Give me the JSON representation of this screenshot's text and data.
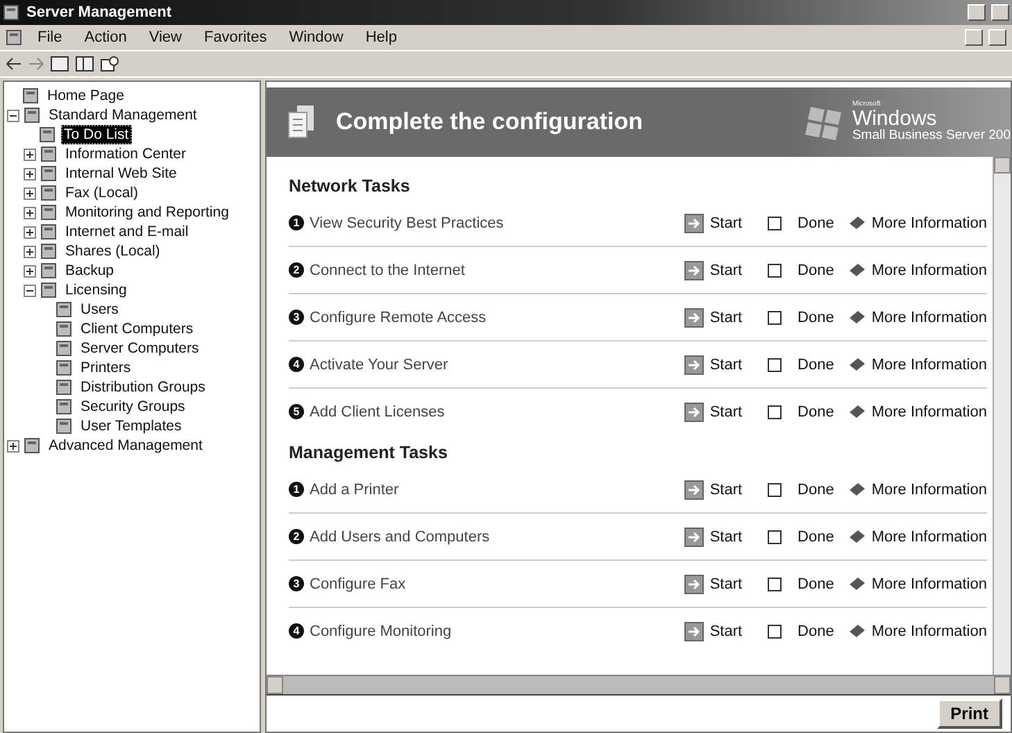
{
  "window": {
    "title": "Server Management"
  },
  "menu": [
    "File",
    "Action",
    "View",
    "Favorites",
    "Window",
    "Help"
  ],
  "tree": [
    {
      "label": "Home Page",
      "selected": false
    },
    {
      "label": "Standard Management",
      "selected": false,
      "expanded": true,
      "children": [
        {
          "label": "To Do List",
          "selected": true
        },
        {
          "label": "Information Center",
          "selected": false,
          "expanded": false
        },
        {
          "label": "Internal Web Site",
          "selected": false,
          "expanded": false
        },
        {
          "label": "Fax (Local)",
          "selected": false,
          "expanded": false
        },
        {
          "label": "Monitoring and Reporting",
          "selected": false,
          "expanded": false
        },
        {
          "label": "Internet and E-mail",
          "selected": false,
          "expanded": false
        },
        {
          "label": "Shares (Local)",
          "selected": false,
          "expanded": false
        },
        {
          "label": "Backup",
          "selected": false,
          "expanded": false
        },
        {
          "label": "Licensing",
          "selected": false,
          "expanded": true,
          "children": [
            {
              "label": "Users",
              "selected": false
            },
            {
              "label": "Client Computers",
              "selected": false
            },
            {
              "label": "Server Computers",
              "selected": false
            },
            {
              "label": "Printers",
              "selected": false
            },
            {
              "label": "Distribution Groups",
              "selected": false
            },
            {
              "label": "Security Groups",
              "selected": false
            },
            {
              "label": "User Templates",
              "selected": false
            }
          ]
        }
      ]
    },
    {
      "label": "Advanced Management",
      "selected": false,
      "expanded": false
    }
  ],
  "header": {
    "title": "Complete the configuration",
    "logo_small": "Microsoft",
    "logo_name": "Windows",
    "logo_product": "Small Business Server 200"
  },
  "sections": [
    {
      "title": "Network Tasks",
      "tasks": [
        {
          "number": "1",
          "label": "View Security Best Practices",
          "start": "Start",
          "done_label": "Done",
          "done": false,
          "info": "More Information"
        },
        {
          "number": "2",
          "label": "Connect to the Internet",
          "start": "Start",
          "done_label": "Done",
          "done": false,
          "info": "More Information"
        },
        {
          "number": "3",
          "label": "Configure Remote Access",
          "start": "Start",
          "done_label": "Done",
          "done": false,
          "info": "More Information"
        },
        {
          "number": "4",
          "label": "Activate Your Server",
          "start": "Start",
          "done_label": "Done",
          "done": false,
          "info": "More Information"
        },
        {
          "number": "5",
          "label": "Add Client Licenses",
          "start": "Start",
          "done_label": "Done",
          "done": false,
          "info": "More Information"
        }
      ]
    },
    {
      "title": "Management Tasks",
      "tasks": [
        {
          "number": "1",
          "label": "Add a Printer",
          "start": "Start",
          "done_label": "Done",
          "done": false,
          "info": "More Information"
        },
        {
          "number": "2",
          "label": "Add Users and Computers",
          "start": "Start",
          "done_label": "Done",
          "done": false,
          "info": "More Information"
        },
        {
          "number": "3",
          "label": "Configure Fax",
          "start": "Start",
          "done_label": "Done",
          "done": false,
          "info": "More Information"
        },
        {
          "number": "4",
          "label": "Configure Monitoring",
          "start": "Start",
          "done_label": "Done",
          "done": false,
          "info": "More Information"
        }
      ]
    }
  ],
  "print_button": "Print"
}
